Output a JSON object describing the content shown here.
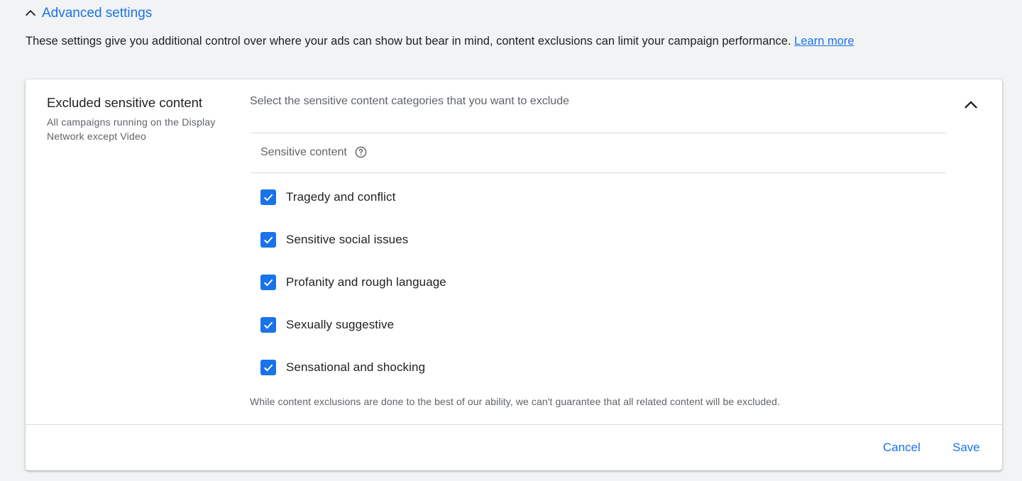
{
  "advanced": {
    "title": "Advanced settings",
    "intro_text": "These settings give you additional control over where your ads can show but bear in mind, content exclusions can limit your campaign performance.",
    "learn_more": "Learn more"
  },
  "card": {
    "heading": "Excluded sensitive content",
    "subtext": "All campaigns running on the Display Network except Video",
    "prompt": "Select the sensitive content categories that you want to exclude",
    "section_label": "Sensitive content",
    "options": [
      {
        "label": "Tragedy and conflict",
        "checked": true
      },
      {
        "label": "Sensitive social issues",
        "checked": true
      },
      {
        "label": "Profanity and rough language",
        "checked": true
      },
      {
        "label": "Sexually suggestive",
        "checked": true
      },
      {
        "label": "Sensational and shocking",
        "checked": true
      }
    ],
    "disclaimer": "While content exclusions are done to the best of our ability, we can't guarantee that all related content will be excluded.",
    "cancel_label": "Cancel",
    "save_label": "Save"
  },
  "colors": {
    "accent": "#1a73e8",
    "background": "#f1f3f4",
    "card": "#ffffff"
  },
  "icons": {
    "expand_toggle": "chevron-up-icon",
    "help": "help-circle-icon",
    "check": "checkmark-icon",
    "collapse": "chevron-up-icon"
  }
}
